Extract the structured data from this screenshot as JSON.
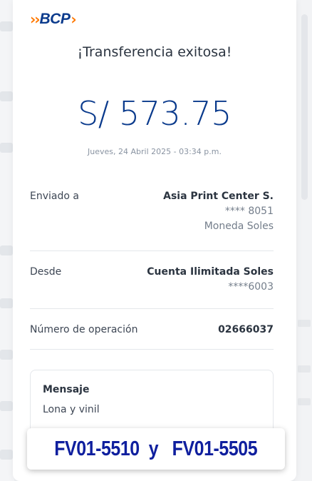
{
  "brand": {
    "logo_text": "BCP"
  },
  "receipt": {
    "title": "¡Transferencia exitosa!",
    "amount": "S/ 573.75",
    "date": "Jueves, 24 Abril 2025 - 03:34 p.m.",
    "sent_to": {
      "label": "Enviado a",
      "name": "Asia Print Center S.",
      "account": "**** 8051",
      "currency": "Moneda Soles"
    },
    "from": {
      "label": "Desde",
      "account_name": "Cuenta Ilimitada Soles",
      "account": "****6003"
    },
    "operation": {
      "label": "Número de operación",
      "number": "02666037"
    },
    "message": {
      "label": "Mensaje",
      "text": "Lona y vinil"
    }
  },
  "overlay_note": "FV01-5510  y   FV01-5505",
  "colors": {
    "brand_blue": "#0a3a8c",
    "brand_orange": "#ff7800",
    "overlay_text": "#0f1f9e"
  }
}
